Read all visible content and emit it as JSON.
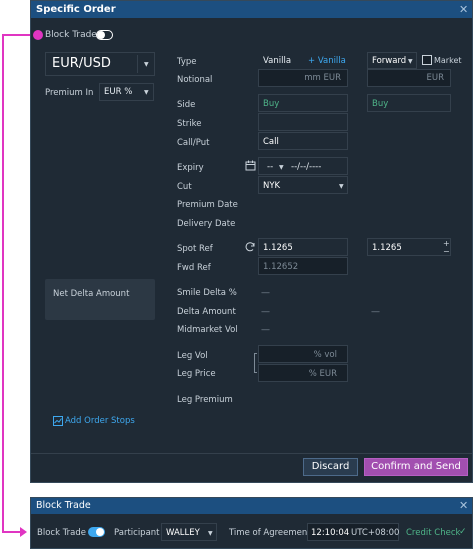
{
  "main": {
    "title": "Specific Order",
    "block_trade_label": "Block Trade",
    "ccy_pair": "EUR/USD",
    "premium_in_label": "Premium In",
    "premium_in_value": "EUR %",
    "net_delta_label": "Net Delta Amount",
    "add_order_stops": "Add Order Stops",
    "labels": {
      "type": "Type",
      "notional": "Notional",
      "side": "Side",
      "strike": "Strike",
      "call_put": "Call/Put",
      "expiry": "Expiry",
      "cut": "Cut",
      "premium_date": "Premium Date",
      "delivery_date": "Delivery Date",
      "spot_ref": "Spot Ref",
      "fwd_ref": "Fwd Ref",
      "smile_delta": "Smile Delta %",
      "delta_amount": "Delta Amount",
      "midmarket_vol": "Midmarket Vol",
      "leg_vol": "Leg Vol",
      "leg_price": "Leg Price",
      "leg_premium": "Leg Premium"
    },
    "leg1": {
      "type": "Vanilla",
      "add_vanilla": "+ Vanilla",
      "notional_placeholder": "mm EUR",
      "side": "Buy",
      "call_put": "Call",
      "expiry_tenor": "--",
      "expiry_date": "--/--/----",
      "cut": "NYK",
      "spot_ref": "1.1265",
      "fwd_ref": "1.12652",
      "smile_delta": "—",
      "delta_amount": "—",
      "midmarket_vol": "—",
      "leg_vol_placeholder": "% vol",
      "leg_price_placeholder": "% EUR"
    },
    "leg2": {
      "type": "Forward",
      "market_label": "Market",
      "notional_placeholder": "EUR",
      "side": "Buy",
      "spot_ref": "1.1265",
      "delta_amount": "—"
    },
    "discard_label": "Discard",
    "confirm_label": "Confirm and Send"
  },
  "block": {
    "title": "Block Trade",
    "block_trade_label": "Block Trade",
    "participant_label": "Participant",
    "participant_value": "WALLEY",
    "time_label": "Time of Agreement",
    "time_value": "12:10:04",
    "tz": "UTC+08:00",
    "credit_check": "Credit Check"
  },
  "colors": {
    "titlebar": "#1c4f80",
    "panel": "#1f2a35",
    "accent_pink": "#e035c2",
    "buy_green": "#4fb589",
    "link_blue": "#3ea8ef",
    "confirm_purple": "#a24fb0"
  },
  "icons": [
    "close-icon",
    "calendar-icon",
    "refresh-icon",
    "chevron-down-icon",
    "add-order-stops-icon",
    "check-icon"
  ]
}
